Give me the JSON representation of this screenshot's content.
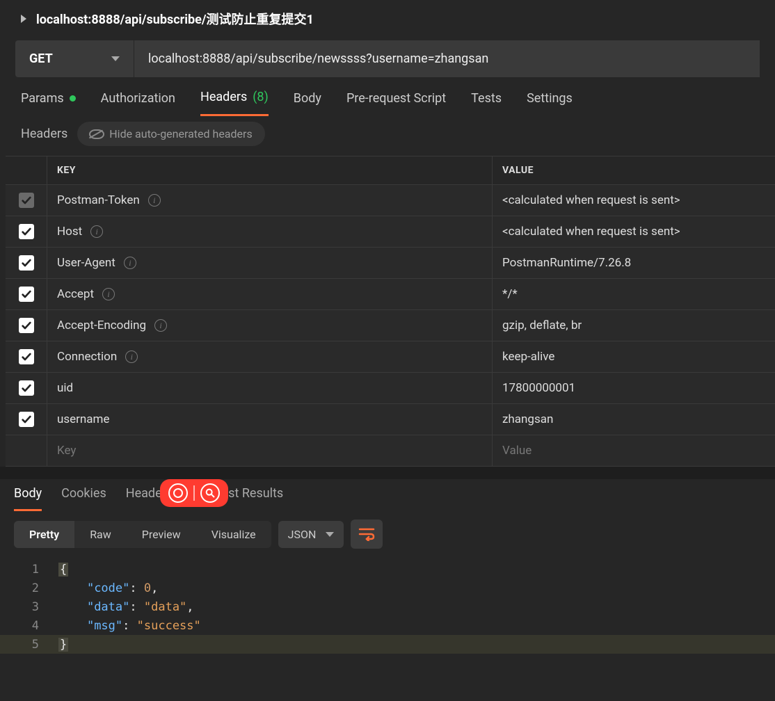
{
  "top_url": "localhost:8888/api/subscribe/测试防止重复提交1",
  "method": "GET",
  "request_url": "localhost:8888/api/subscribe/newssss?username=zhangsan",
  "tabs": {
    "params": "Params",
    "auth": "Authorization",
    "headers": "Headers",
    "headers_count": "(8)",
    "body": "Body",
    "prereq": "Pre-request Script",
    "tests": "Tests",
    "settings": "Settings"
  },
  "sub": {
    "title": "Headers",
    "hide": "Hide auto-generated headers"
  },
  "th": {
    "key": "KEY",
    "value": "VALUE"
  },
  "rows": [
    {
      "k": "Postman-Token",
      "v": "<calculated when request is sent>",
      "info": true,
      "grey": true
    },
    {
      "k": "Host",
      "v": "<calculated when request is sent>",
      "info": true,
      "grey": false
    },
    {
      "k": "User-Agent",
      "v": "PostmanRuntime/7.26.8",
      "info": true,
      "grey": false
    },
    {
      "k": "Accept",
      "v": "*/*",
      "info": true,
      "grey": false
    },
    {
      "k": "Accept-Encoding",
      "v": "gzip, deflate, br",
      "info": true,
      "grey": false
    },
    {
      "k": "Connection",
      "v": "keep-alive",
      "info": true,
      "grey": false
    },
    {
      "k": "uid",
      "v": "17800000001",
      "info": false,
      "grey": false
    },
    {
      "k": "username",
      "v": "zhangsan",
      "info": false,
      "grey": false
    }
  ],
  "ph": {
    "key": "Key",
    "value": "Value"
  },
  "resp_tabs": {
    "body": "Body",
    "cookies": "Cookies",
    "headers": "Heade",
    "tests": "est Results"
  },
  "view": {
    "pretty": "Pretty",
    "raw": "Raw",
    "preview": "Preview",
    "visualize": "Visualize",
    "fmt": "JSON"
  },
  "json": {
    "lines": [
      "1",
      "2",
      "3",
      "4",
      "5"
    ],
    "code_key": "\"code\"",
    "code_val": "0",
    "data_key": "\"data\"",
    "data_val": "\"data\"",
    "msg_key": "\"msg\"",
    "msg_val": "\"success\"",
    "ob": "{",
    "cb": "}",
    "colon": ":",
    "comma": ","
  }
}
